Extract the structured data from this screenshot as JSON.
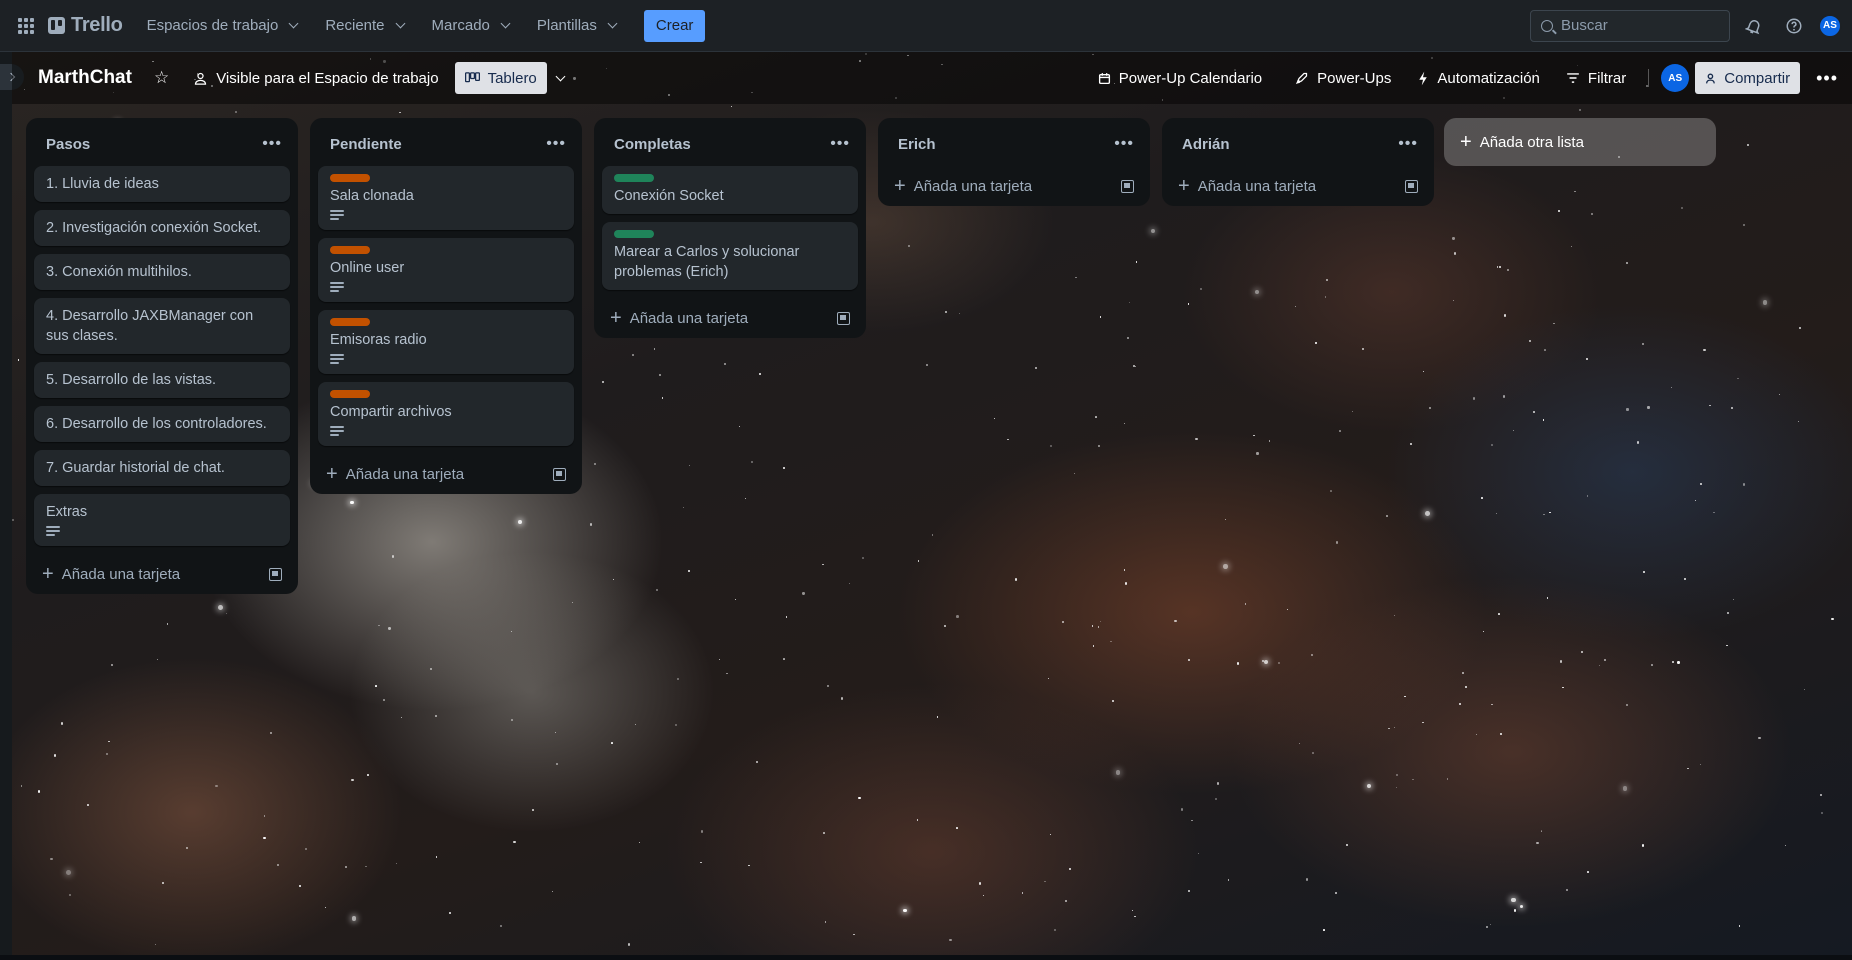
{
  "topnav": {
    "apps_icon": "grid-icon",
    "logo_text": "Trello",
    "menus": [
      {
        "label": "Espacios de trabajo"
      },
      {
        "label": "Reciente"
      },
      {
        "label": "Marcado"
      },
      {
        "label": "Plantillas"
      }
    ],
    "create_label": "Crear",
    "search_placeholder": "Buscar",
    "avatar_initials": "AS",
    "accent": "#579dff"
  },
  "board": {
    "title": "MarthChat",
    "visibility_label": "Visible para el Espacio de trabajo",
    "view_label": "Tablero",
    "powerup_calendar_label": "Power-Up Calendario",
    "powerups_label": "Power-Ups",
    "automation_label": "Automatización",
    "filter_label": "Filtrar",
    "member_initials": "AS",
    "share_label": "Compartir"
  },
  "label_colors": {
    "orange": "#c25100",
    "green": "#1f845a"
  },
  "lists": [
    {
      "title": "Pasos",
      "cards": [
        {
          "title": "1. Lluvia de ideas"
        },
        {
          "title": "2. Investigación conexión Socket."
        },
        {
          "title": "3. Conexión multihilos."
        },
        {
          "title": "4. Desarrollo JAXBManager con sus clases."
        },
        {
          "title": "5. Desarrollo de las vistas."
        },
        {
          "title": "6. Desarrollo de los controladores."
        },
        {
          "title": "7. Guardar historial de chat."
        },
        {
          "title": "Extras",
          "has_description": true
        }
      ],
      "add_card_label": "Añada una tarjeta"
    },
    {
      "title": "Pendiente",
      "cards": [
        {
          "title": "Sala clonada",
          "label": "orange",
          "has_description": true
        },
        {
          "title": "Online user",
          "label": "orange",
          "has_description": true
        },
        {
          "title": "Emisoras radio",
          "label": "orange",
          "has_description": true
        },
        {
          "title": "Compartir archivos",
          "label": "orange",
          "has_description": true
        }
      ],
      "add_card_label": "Añada una tarjeta"
    },
    {
      "title": "Completas",
      "cards": [
        {
          "title": "Conexión Socket",
          "label": "green"
        },
        {
          "title": "Marear a Carlos y solucionar problemas (Erich)",
          "label": "green"
        }
      ],
      "add_card_label": "Añada una tarjeta"
    },
    {
      "title": "Erich",
      "cards": [],
      "add_card_label": "Añada una tarjeta"
    },
    {
      "title": "Adrián",
      "cards": [],
      "add_card_label": "Añada una tarjeta"
    }
  ],
  "add_list_label": "Añada otra lista"
}
